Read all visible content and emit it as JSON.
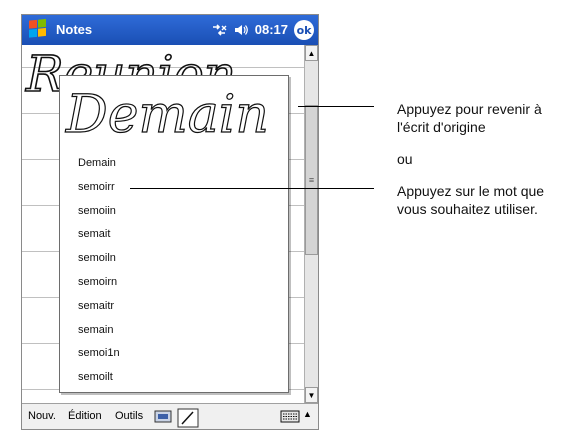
{
  "titlebar": {
    "app_title": "Notes",
    "time": "08:17",
    "ok_label": "ok"
  },
  "note": {
    "handwriting_top": "Reunion"
  },
  "popup": {
    "ink_word": "Demain",
    "suggestions": [
      "Demain",
      "semoirr",
      "semoiin",
      "semait",
      "semoiln",
      "semoirn",
      "semaitr",
      "semain",
      "semoi1n",
      "semoilt"
    ]
  },
  "toolbar": {
    "new_label": "Nouv.",
    "edit_label": "Édition",
    "tools_label": "Outils"
  },
  "annotations": {
    "callout1_line1": "Appuyez pour revenir à",
    "callout1_line2": "l'écrit d'origine",
    "or_label": "ou",
    "callout2_line1": "Appuyez sur le mot que",
    "callout2_line2": "vous souhaitez utiliser."
  },
  "icons": {
    "start": "windows-flag-icon",
    "connectivity": "connectivity-icon",
    "volume": "speaker-icon",
    "keyboard": "keyboard-icon",
    "pen": "pen-icon"
  },
  "colors": {
    "titlebar": "#1a4fb4",
    "ruled_line": "#c0c0c0"
  }
}
